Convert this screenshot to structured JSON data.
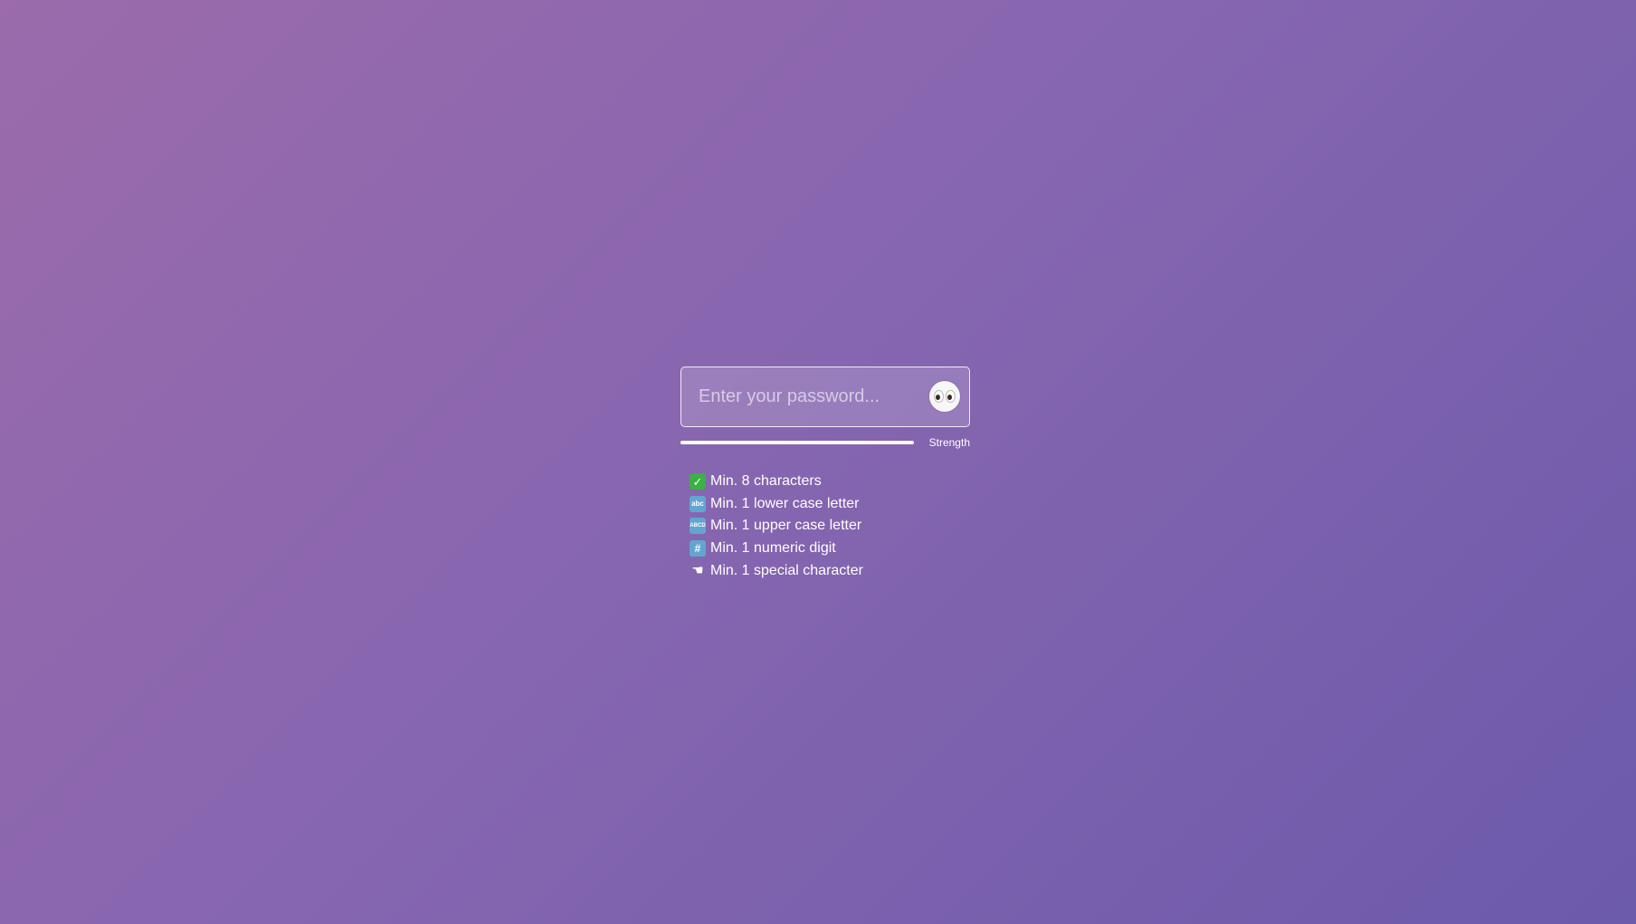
{
  "password": {
    "value": "",
    "placeholder": "Enter your password...",
    "toggle_icon": "eyes-icon"
  },
  "strength": {
    "label": "Strength",
    "level": 0,
    "track_color": "#ffffff"
  },
  "requirements": [
    {
      "icon": "check-mark-icon",
      "glyph": "✓",
      "label": "Min. 8 characters"
    },
    {
      "icon": "abc-lowercase-icon",
      "glyph": "abc",
      "label": "Min. 1 lower case letter"
    },
    {
      "icon": "abcd-uppercase-icon",
      "glyph": "ABCD",
      "label": "Min. 1 upper case letter"
    },
    {
      "icon": "hash-icon",
      "glyph": "#",
      "label": "Min. 1 numeric digit"
    },
    {
      "icon": "pointing-hand-icon",
      "glyph": "☚",
      "label": "Min. 1 special character"
    }
  ],
  "colors": {
    "background_start": "#9b6bab",
    "background_end": "#6c5aab",
    "check_green": "#3cb043",
    "key_blue": "#62a6cf"
  }
}
